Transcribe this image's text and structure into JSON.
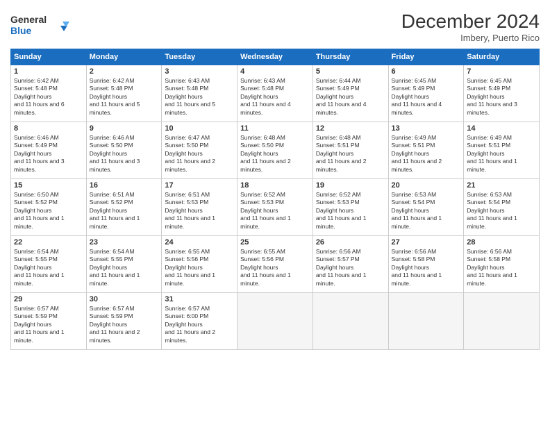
{
  "header": {
    "logo_line1": "General",
    "logo_line2": "Blue",
    "month": "December 2024",
    "location": "Imbery, Puerto Rico"
  },
  "weekdays": [
    "Sunday",
    "Monday",
    "Tuesday",
    "Wednesday",
    "Thursday",
    "Friday",
    "Saturday"
  ],
  "weeks": [
    [
      {
        "day": "1",
        "sunrise": "6:42 AM",
        "sunset": "5:48 PM",
        "daylight": "11 hours and 6 minutes."
      },
      {
        "day": "2",
        "sunrise": "6:42 AM",
        "sunset": "5:48 PM",
        "daylight": "11 hours and 5 minutes."
      },
      {
        "day": "3",
        "sunrise": "6:43 AM",
        "sunset": "5:48 PM",
        "daylight": "11 hours and 5 minutes."
      },
      {
        "day": "4",
        "sunrise": "6:43 AM",
        "sunset": "5:48 PM",
        "daylight": "11 hours and 4 minutes."
      },
      {
        "day": "5",
        "sunrise": "6:44 AM",
        "sunset": "5:49 PM",
        "daylight": "11 hours and 4 minutes."
      },
      {
        "day": "6",
        "sunrise": "6:45 AM",
        "sunset": "5:49 PM",
        "daylight": "11 hours and 4 minutes."
      },
      {
        "day": "7",
        "sunrise": "6:45 AM",
        "sunset": "5:49 PM",
        "daylight": "11 hours and 3 minutes."
      }
    ],
    [
      {
        "day": "8",
        "sunrise": "6:46 AM",
        "sunset": "5:49 PM",
        "daylight": "11 hours and 3 minutes."
      },
      {
        "day": "9",
        "sunrise": "6:46 AM",
        "sunset": "5:50 PM",
        "daylight": "11 hours and 3 minutes."
      },
      {
        "day": "10",
        "sunrise": "6:47 AM",
        "sunset": "5:50 PM",
        "daylight": "11 hours and 2 minutes."
      },
      {
        "day": "11",
        "sunrise": "6:48 AM",
        "sunset": "5:50 PM",
        "daylight": "11 hours and 2 minutes."
      },
      {
        "day": "12",
        "sunrise": "6:48 AM",
        "sunset": "5:51 PM",
        "daylight": "11 hours and 2 minutes."
      },
      {
        "day": "13",
        "sunrise": "6:49 AM",
        "sunset": "5:51 PM",
        "daylight": "11 hours and 2 minutes."
      },
      {
        "day": "14",
        "sunrise": "6:49 AM",
        "sunset": "5:51 PM",
        "daylight": "11 hours and 1 minute."
      }
    ],
    [
      {
        "day": "15",
        "sunrise": "6:50 AM",
        "sunset": "5:52 PM",
        "daylight": "11 hours and 1 minute."
      },
      {
        "day": "16",
        "sunrise": "6:51 AM",
        "sunset": "5:52 PM",
        "daylight": "11 hours and 1 minute."
      },
      {
        "day": "17",
        "sunrise": "6:51 AM",
        "sunset": "5:53 PM",
        "daylight": "11 hours and 1 minute."
      },
      {
        "day": "18",
        "sunrise": "6:52 AM",
        "sunset": "5:53 PM",
        "daylight": "11 hours and 1 minute."
      },
      {
        "day": "19",
        "sunrise": "6:52 AM",
        "sunset": "5:53 PM",
        "daylight": "11 hours and 1 minute."
      },
      {
        "day": "20",
        "sunrise": "6:53 AM",
        "sunset": "5:54 PM",
        "daylight": "11 hours and 1 minute."
      },
      {
        "day": "21",
        "sunrise": "6:53 AM",
        "sunset": "5:54 PM",
        "daylight": "11 hours and 1 minute."
      }
    ],
    [
      {
        "day": "22",
        "sunrise": "6:54 AM",
        "sunset": "5:55 PM",
        "daylight": "11 hours and 1 minute."
      },
      {
        "day": "23",
        "sunrise": "6:54 AM",
        "sunset": "5:55 PM",
        "daylight": "11 hours and 1 minute."
      },
      {
        "day": "24",
        "sunrise": "6:55 AM",
        "sunset": "5:56 PM",
        "daylight": "11 hours and 1 minute."
      },
      {
        "day": "25",
        "sunrise": "6:55 AM",
        "sunset": "5:56 PM",
        "daylight": "11 hours and 1 minute."
      },
      {
        "day": "26",
        "sunrise": "6:56 AM",
        "sunset": "5:57 PM",
        "daylight": "11 hours and 1 minute."
      },
      {
        "day": "27",
        "sunrise": "6:56 AM",
        "sunset": "5:58 PM",
        "daylight": "11 hours and 1 minute."
      },
      {
        "day": "28",
        "sunrise": "6:56 AM",
        "sunset": "5:58 PM",
        "daylight": "11 hours and 1 minute."
      }
    ],
    [
      {
        "day": "29",
        "sunrise": "6:57 AM",
        "sunset": "5:59 PM",
        "daylight": "11 hours and 1 minute."
      },
      {
        "day": "30",
        "sunrise": "6:57 AM",
        "sunset": "5:59 PM",
        "daylight": "11 hours and 2 minutes."
      },
      {
        "day": "31",
        "sunrise": "6:57 AM",
        "sunset": "6:00 PM",
        "daylight": "11 hours and 2 minutes."
      },
      null,
      null,
      null,
      null
    ]
  ]
}
